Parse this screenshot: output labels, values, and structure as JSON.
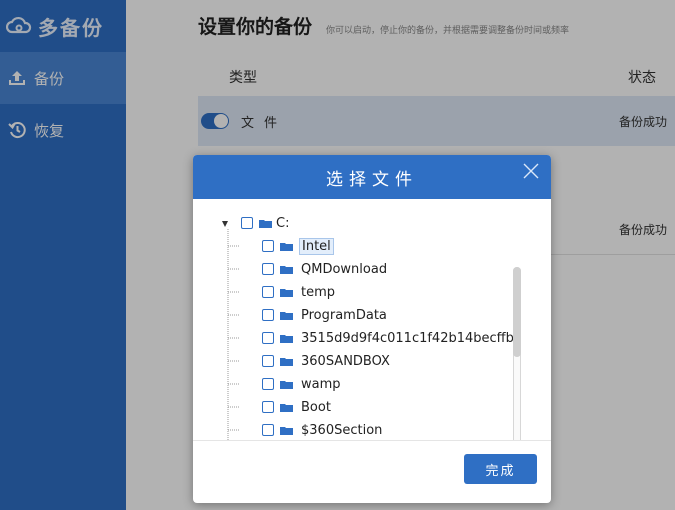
{
  "sidebar": {
    "brand": "多备份",
    "items": [
      {
        "label": "备份",
        "icon": "upload-icon",
        "active": true
      },
      {
        "label": "恢复",
        "icon": "history-icon",
        "active": false
      }
    ],
    "bg_color": "#2f6fc4",
    "active_color": "#4a86d4"
  },
  "main": {
    "title": "设置你的备份",
    "subtitle": "你可以启动，停止你的备份，并根据需要调整备份时间或频率",
    "columns": {
      "type": "类型",
      "status": "状态"
    },
    "rows": [
      {
        "label": "文件",
        "status": "备份成功",
        "enabled": true
      },
      {
        "label": "",
        "status": "备份成功",
        "enabled": true
      }
    ]
  },
  "dialog": {
    "title": "选择文件",
    "root": "C:",
    "folders": [
      "Intel",
      "QMDownload",
      "temp",
      "ProgramData",
      "3515d9d9f4c011c1f42b14becffb",
      "360SANDBOX",
      "wamp",
      "Boot",
      "$360Section"
    ],
    "selected_folder": "Intel",
    "done_label": "完成",
    "accent_color": "#2f6fc4"
  }
}
